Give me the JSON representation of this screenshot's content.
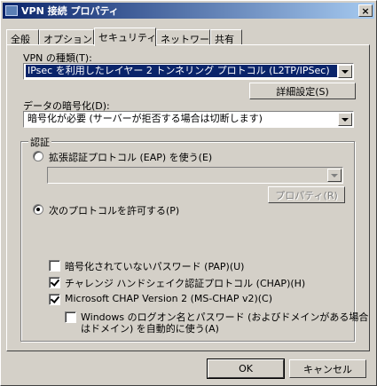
{
  "window": {
    "title": "VPN 接続 プロパティ",
    "close_glyph": "×"
  },
  "tabs": [
    {
      "label": "全般"
    },
    {
      "label": "オプション"
    },
    {
      "label": "セキュリティ"
    },
    {
      "label": "ネットワーク"
    },
    {
      "label": "共有"
    }
  ],
  "vpn_type": {
    "label": "VPN の種類(T):",
    "value": "IPsec を利用したレイヤー 2 トンネリング プロトコル (L2TP/IPSec)"
  },
  "advanced_button": {
    "label": "詳細設定(S)"
  },
  "encryption": {
    "label": "データの暗号化(D):",
    "value": "暗号化が必要 (サーバーが拒否する場合は切断します)"
  },
  "auth_group": {
    "label": "認証",
    "eap_radio": {
      "label": "拡張認証プロトコル (EAP) を使う(E)",
      "selected": false
    },
    "eap_combo": {
      "value": ""
    },
    "properties_button": {
      "label": "プロパティ(R)"
    },
    "allow_radio": {
      "label": "次のプロトコルを許可する(P)",
      "selected": true
    },
    "protocols": [
      {
        "label": "暗号化されていないパスワード (PAP)(U)",
        "checked": false
      },
      {
        "label": "チャレンジ ハンドシェイク認証プロトコル (CHAP)(H)",
        "checked": true
      },
      {
        "label": "Microsoft CHAP Version 2 (MS-CHAP v2)(C)",
        "checked": true
      }
    ],
    "windows_logon": {
      "label_line1": "Windows のログオン名とパスワード (およびドメインがある場合",
      "label_line2": "はドメイン) を自動的に使う(A)",
      "checked": false
    }
  },
  "footer": {
    "ok_label": "OK",
    "cancel_label": "キャンセル"
  }
}
